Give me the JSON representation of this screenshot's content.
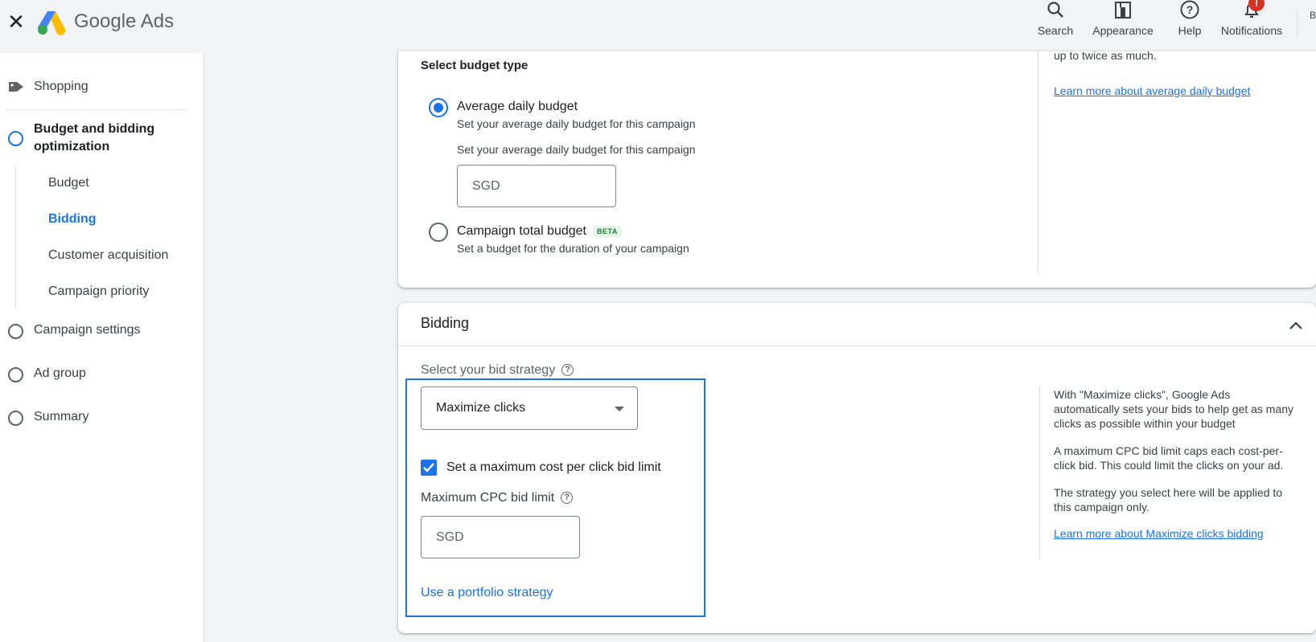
{
  "topbar": {
    "brand_google": "Google",
    "brand_ads": "Ads",
    "search_label": "Search",
    "appearance_label": "Appearance",
    "help_label": "Help",
    "notifications_label": "Notifications",
    "notifications_badge": "!",
    "account_letter": "B"
  },
  "sidebar": {
    "shopping": "Shopping",
    "budget_bidding": "Budget and bidding optimization",
    "sub_items": [
      "Budget",
      "Bidding",
      "Customer acquisition",
      "Campaign priority"
    ],
    "campaign_settings": "Campaign settings",
    "ad_group": "Ad group",
    "summary": "Summary"
  },
  "budget_card": {
    "section_title": "Select budget type",
    "option1_title": "Average daily budget",
    "option1_desc": "Set your average daily budget for this campaign",
    "input_label": "Set your average daily budget for this campaign",
    "input_currency": "SGD",
    "option2_title": "Campaign total budget",
    "option2_badge": "BETA",
    "option2_desc": "Set a budget for the duration of your campaign",
    "side_text_partial": "up to twice as much.",
    "side_link": "Learn more about average daily budget"
  },
  "bidding_card": {
    "title": "Bidding",
    "strategy_label": "Select your bid strategy",
    "strategy_value": "Maximize clicks",
    "checkbox_label": "Set a maximum cost per click bid limit",
    "cpc_label": "Maximum CPC bid limit",
    "cpc_currency": "SGD",
    "portfolio_link": "Use a portfolio strategy",
    "side_para1": "With \"Maximize clicks\", Google Ads automatically sets your bids to help get as many clicks as possible within your budget",
    "side_para2": "A maximum CPC bid limit caps each cost-per-click bid. This could limit the clicks on your ad.",
    "side_para3": "The strategy you select here will be applied to this campaign only.",
    "side_link": "Learn more about Maximize clicks bidding"
  },
  "colors": {
    "accent": "#1a73e8",
    "background": "#f1f3f4",
    "beta_green": "#188038",
    "notification_red": "#d93025"
  }
}
